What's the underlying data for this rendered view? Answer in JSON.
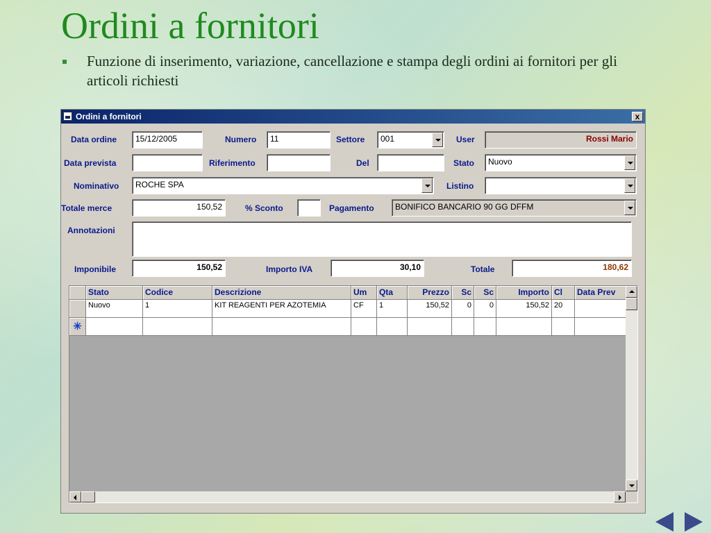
{
  "slide": {
    "title": "Ordini a fornitori",
    "bullet": "Funzione di inserimento, variazione, cancellazione e stampa degli ordini ai fornitori per gli articoli richiesti"
  },
  "window": {
    "title": "Ordini a fornitori",
    "close_label": "x"
  },
  "form": {
    "data_ordine": {
      "label": "Data ordine",
      "value": "15/12/2005"
    },
    "numero": {
      "label": "Numero",
      "value": "11"
    },
    "settore": {
      "label": "Settore",
      "value": "001"
    },
    "user": {
      "label": "User",
      "value": "Rossi Mario"
    },
    "data_prevista": {
      "label": "Data prevista",
      "value": ""
    },
    "riferimento": {
      "label": "Riferimento",
      "value": ""
    },
    "del": {
      "label": "Del",
      "value": ""
    },
    "stato": {
      "label": "Stato",
      "value": "Nuovo"
    },
    "nominativo": {
      "label": "Nominativo",
      "value": "ROCHE SPA"
    },
    "listino": {
      "label": "Listino",
      "value": ""
    },
    "totale_merce": {
      "label": "Totale merce",
      "value": "150,52"
    },
    "sconto": {
      "label": "% Sconto",
      "value": ""
    },
    "pagamento": {
      "label": "Pagamento",
      "value": "BONIFICO BANCARIO 90 GG DFFM"
    },
    "annotazioni": {
      "label": "Annotazioni",
      "value": ""
    },
    "imponibile": {
      "label": "Imponibile",
      "value": "150,52"
    },
    "importo_iva": {
      "label": "Importo IVA",
      "value": "30,10"
    },
    "totale": {
      "label": "Totale",
      "value": "180,62"
    }
  },
  "grid": {
    "columns": [
      "Stato",
      "Codice",
      "Descrizione",
      "Um",
      "Qta",
      "Prezzo",
      "Sc",
      "Sc",
      "Importo",
      "Cl",
      "Data Prev"
    ],
    "rows": [
      [
        "Nuovo",
        "1",
        "KIT REAGENTI PER AZOTEMIA",
        "CF",
        "1",
        "150,52",
        "0",
        "0",
        "150,52",
        "20",
        ""
      ]
    ],
    "new_row_marker": "✳"
  }
}
